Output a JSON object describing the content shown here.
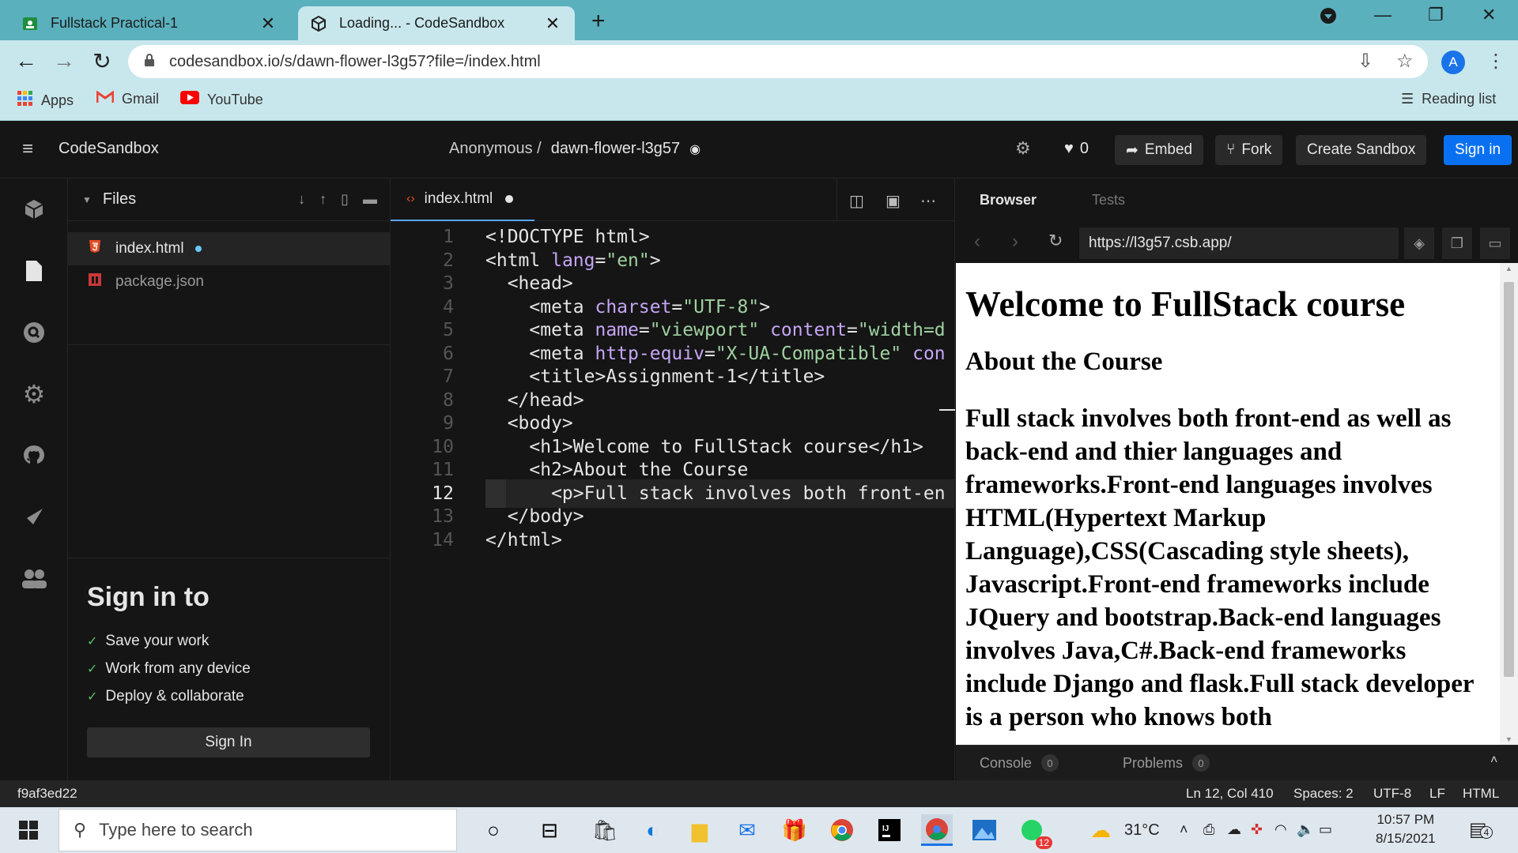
{
  "browser": {
    "tabs": [
      {
        "title": "Fullstack Practical-1",
        "close": "✕"
      },
      {
        "title": "Loading... - CodeSandbox",
        "close": "✕"
      }
    ],
    "new_tab": "+",
    "url": "codesandbox.io/s/dawn-flower-l3g57?file=/index.html",
    "profile_initial": "A",
    "bookmarks": [
      "Apps",
      "Gmail",
      "YouTube"
    ],
    "reading_list": "Reading list"
  },
  "codesandbox": {
    "brand": "CodeSandbox",
    "owner": "Anonymous /",
    "sandbox_name": "dawn-flower-l3g57",
    "likes": "0",
    "buttons": {
      "embed": "Embed",
      "fork": "Fork",
      "create": "Create Sandbox",
      "signin": "Sign in"
    }
  },
  "files_panel": {
    "title": "Files",
    "files": [
      {
        "name": "index.html",
        "selected": true
      },
      {
        "name": "package.json",
        "selected": false
      }
    ],
    "signin_title": "Sign in to",
    "benefits": [
      "Save your work",
      "Work from any device",
      "Deploy & collaborate"
    ],
    "signin_button": "Sign In"
  },
  "editor": {
    "tab_name": "index.html",
    "lines": [
      {
        "n": "1",
        "code": "<!DOCTYPE html>"
      },
      {
        "n": "2",
        "code": "<html lang=\"en\">"
      },
      {
        "n": "3",
        "code": "  <head>"
      },
      {
        "n": "4",
        "code": "    <meta charset=\"UTF-8\">"
      },
      {
        "n": "5",
        "code": "    <meta name=\"viewport\" content=\"width=d"
      },
      {
        "n": "6",
        "code": "    <meta http-equiv=\"X-UA-Compatible\" con"
      },
      {
        "n": "7",
        "code": "    <title>Assignment-1</title>"
      },
      {
        "n": "8",
        "code": "  </head>"
      },
      {
        "n": "9",
        "code": "  <body>"
      },
      {
        "n": "10",
        "code": "    <h1>Welcome to FullStack course</h1>"
      },
      {
        "n": "11",
        "code": "    <h2>About the Course"
      },
      {
        "n": "12",
        "code": "      <p>Full stack involves both front-en"
      },
      {
        "n": "13",
        "code": "  </body>"
      },
      {
        "n": "14",
        "code": "</html>"
      }
    ]
  },
  "preview": {
    "tabs": [
      "Browser",
      "Tests"
    ],
    "url": "https://l3g57.csb.app/",
    "h1": "Welcome to FullStack course",
    "h2": "About the Course",
    "paragraph": "Full stack involves both front-end as well as back-end and thier languages and frameworks.Front-end languages involves HTML(Hypertext Markup Language),CSS(Cascading style sheets), Javascript.Front-end frameworks include JQuery and bootstrap.Back-end languages involves Java,C#.Back-end frameworks include Django and flask.Full stack developer is a person who knows both",
    "console": "Console",
    "console_count": "0",
    "problems": "Problems",
    "problems_count": "0"
  },
  "statusbar": {
    "commit": "f9af3ed22",
    "position": "Ln 12, Col 410",
    "spaces": "Spaces: 2",
    "encoding": "UTF-8",
    "eol": "LF",
    "language": "HTML"
  },
  "taskbar": {
    "search_placeholder": "Type here to search",
    "temperature": "31°C",
    "time": "10:57 PM",
    "date": "8/15/2021",
    "whatsapp_badge": "12",
    "notification_count": "4"
  }
}
